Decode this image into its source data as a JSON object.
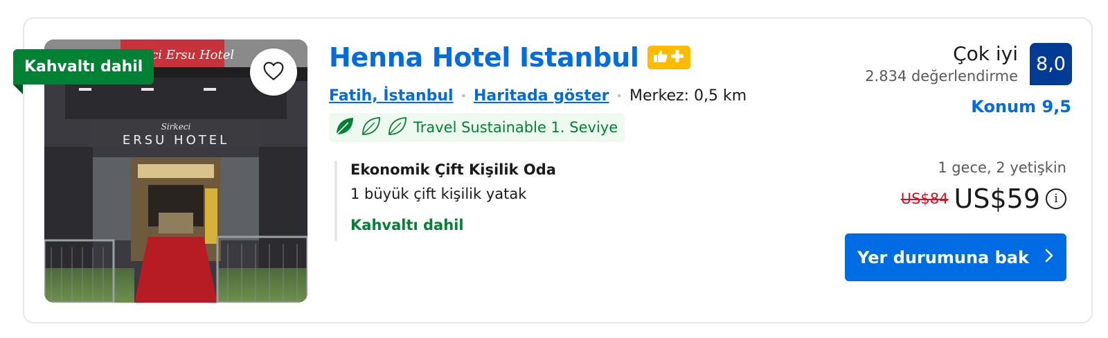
{
  "listing": {
    "badge": "Kahvaltı dahil",
    "title": "Henna Hotel Istanbul",
    "genius_badge": "thumbs-up-plus-icon",
    "location": {
      "area": "Fatih, İstanbul",
      "map_link": "Haritada göster",
      "distance": "Merkez: 0,5 km"
    },
    "sustainability": "Travel Sustainable 1. Seviye",
    "room": {
      "name": "Ekonomik Çift Kişilik Oda",
      "bed": "1 büyük çift kişilik yatak",
      "breakfast": "Kahvaltı dahil"
    },
    "photo_sign": {
      "awning": "Sirkeci Ersu Hotel",
      "script": "Sirkeci",
      "name": "ERSU  HOTEL"
    }
  },
  "review": {
    "label": "Çok iyi",
    "count": "2.834 değerlendirme",
    "score": "8,0",
    "location_score": "Konum 9,5"
  },
  "pricing": {
    "stay": "1 gece, 2 yetişkin",
    "original": "US$84",
    "current": "US$59",
    "info_icon": "i"
  },
  "cta": {
    "label": "Yer durumuna bak"
  },
  "colors": {
    "link_blue": "#006ce4",
    "score_navy": "#003b95",
    "green": "#008234",
    "genius_yellow": "#febb02",
    "strike_red": "#d4111e"
  }
}
